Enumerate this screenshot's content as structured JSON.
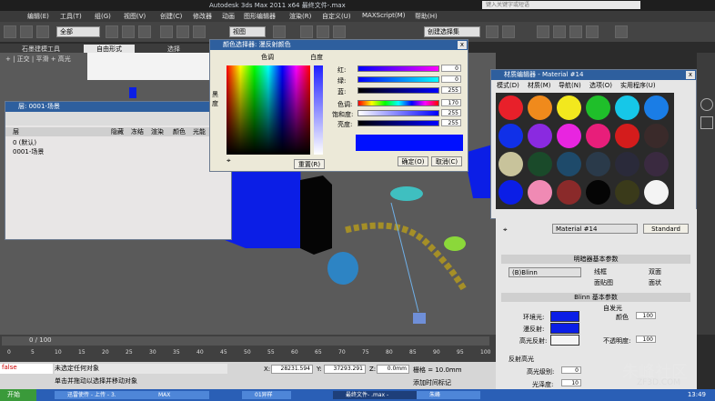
{
  "app": {
    "title": "Autodesk 3ds Max  2011 x64      最终文件-.max",
    "search_placeholder": "键入关键字或短语",
    "watermark_top": "优酷"
  },
  "menu": [
    "编辑(E)",
    "工具(T)",
    "组(G)",
    "视图(V)",
    "创建(C)",
    "修改器",
    "动画",
    "图形编辑器",
    "渲染(R)",
    "自定义(U)",
    "MAXScript(M)",
    "帮助(H)"
  ],
  "toolbar": {
    "selection_filter": "全部",
    "viewport_combo": "视图",
    "selection_set": "创建选择集"
  },
  "ribbon": {
    "tab1": "石墨建模工具",
    "tab2": "自由形式",
    "tab3": "选择"
  },
  "viewport": {
    "label": "+ | 正交 | 平滑 + 高光"
  },
  "layer_dialog": {
    "title": "层: 0001-场景",
    "columns": [
      "层",
      "隐藏",
      "冻结",
      "渲染",
      "颜色",
      "光能"
    ],
    "rows": [
      {
        "name": "0 (默认)"
      },
      {
        "name": "0001-场景"
      }
    ]
  },
  "color_picker": {
    "title": "颜色选择器: 漫反射颜色",
    "hue_label": "色调",
    "whiteness_label": "白度",
    "blackness_label": "黑度",
    "channels": [
      {
        "label": "红:",
        "value": "0"
      },
      {
        "label": "绿:",
        "value": "0"
      },
      {
        "label": "蓝:",
        "value": "255"
      },
      {
        "label": "色调:",
        "value": "170"
      },
      {
        "label": "饱和度:",
        "value": "255"
      },
      {
        "label": "亮度:",
        "value": "255"
      }
    ],
    "reset_button": "重置(R)",
    "ok_button": "确定(O)",
    "cancel_button": "取消(C)",
    "current_color": "#0010ff"
  },
  "material_editor": {
    "title": "材质编辑器 - Material #14",
    "menu": [
      "模式(D)",
      "材质(M)",
      "导航(N)",
      "选项(O)",
      "实用程序(U)"
    ],
    "swatches": [
      "#e8202a",
      "#f08a1c",
      "#f2e81e",
      "#1fbf2a",
      "#16c7e8",
      "#1a7de6",
      "#1030e8",
      "#8a2ae0",
      "#e825e0",
      "#e81e7a",
      "#d41c1c",
      "#3a2a2a",
      "#c8c39b",
      "#1a4a2a",
      "#1e4a6a",
      "#2a3a4a",
      "#2a2a3a",
      "#3a2a40",
      "#0b1ee6",
      "#f08ab4",
      "#8a2a2a",
      "#050505",
      "#3a3a1a",
      "#f4f4f4"
    ],
    "material_name": "Material #14",
    "type_button": "Standard",
    "shader_rollout": "明暗器基本参数",
    "shader_type": "(B)Blinn",
    "options": [
      "线框",
      "双面",
      "面贴图",
      "面状"
    ],
    "blinn_rollout": "Blinn 基本参数",
    "self_illum": "自发光",
    "color_label": "颜色",
    "self_illum_value": "100",
    "opacity_label": "不透明度:",
    "opacity_value": "100",
    "ambient_label": "环境光:",
    "diffuse_label": "漫反射:",
    "specular_label": "高光反射:",
    "spec_rollout": "反射高光",
    "spec_level_label": "高光级别:",
    "spec_level_value": "0",
    "gloss_label": "光泽度:",
    "gloss_value": "10"
  },
  "timeline": {
    "counter": "0 / 100",
    "ticks": [
      "0",
      "5",
      "10",
      "15",
      "20",
      "25",
      "30",
      "35",
      "40",
      "45",
      "50",
      "55",
      "60",
      "65",
      "70",
      "75",
      "80",
      "85",
      "90",
      "95",
      "100"
    ]
  },
  "status": {
    "script": "false",
    "line1": "未选定任何对象",
    "line2": "单击并拖动以选择并移动对象",
    "x_label": "X:",
    "x_value": "28231.594",
    "y_label": "Y:",
    "y_value": "37293.291",
    "z_label": "Z:",
    "z_value": "0.0mm",
    "grid": "栅格 = 10.0mm",
    "add_time_tag": "添加时间标记"
  },
  "taskbar": {
    "start": "开始",
    "tasks": [
      "迅雷使传 - 上传 - 3.",
      "MAX",
      "01异样",
      "最终文件- .max -",
      "朱峰"
    ],
    "clock": "13:49"
  },
  "watermark": {
    "brand": "朱峰社区",
    "url": "ZF3D.COM"
  }
}
